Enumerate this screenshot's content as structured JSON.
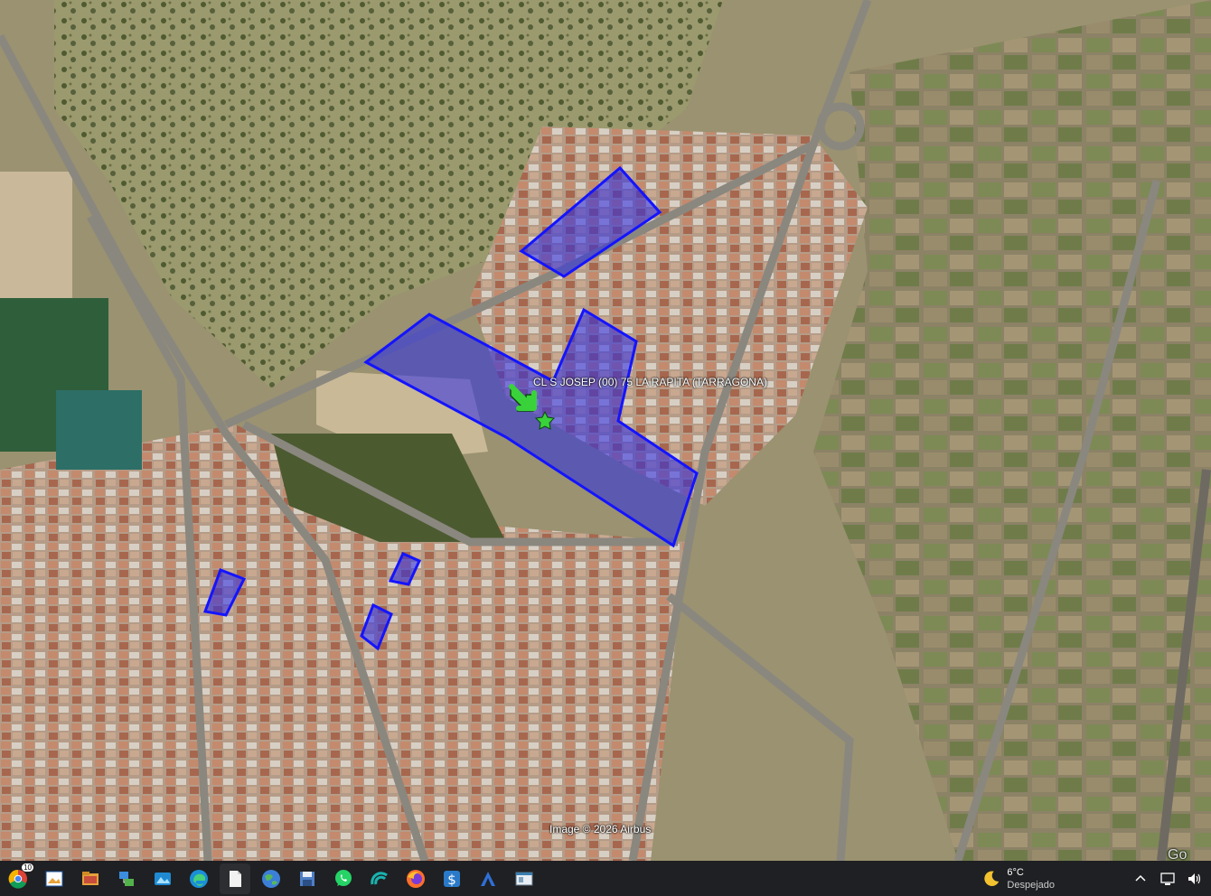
{
  "map": {
    "placemark_label": "CL S JOSEP (00) 75  LA RAPITA (TARRAGONA)",
    "attribution": "Image © 2026 Airbus",
    "corner_logo": "Go",
    "parcel_color": "#2a2ae8"
  },
  "taskbar": {
    "apps": [
      {
        "name": "chrome-icon",
        "badge": "10"
      },
      {
        "name": "image-viewer-icon"
      },
      {
        "name": "file-explorer-icon"
      },
      {
        "name": "network-tool-icon"
      },
      {
        "name": "photos-icon"
      },
      {
        "name": "edge-icon"
      },
      {
        "name": "blank-document-icon"
      },
      {
        "name": "google-earth-icon"
      },
      {
        "name": "save-disk-icon"
      },
      {
        "name": "whatsapp-icon"
      },
      {
        "name": "teal-app-icon"
      },
      {
        "name": "firefox-icon"
      },
      {
        "name": "dollar-app-icon"
      },
      {
        "name": "autocad-icon"
      },
      {
        "name": "spreadsheet-window-icon"
      }
    ],
    "weather": {
      "temperature": "6°C",
      "condition": "Despejado"
    }
  }
}
